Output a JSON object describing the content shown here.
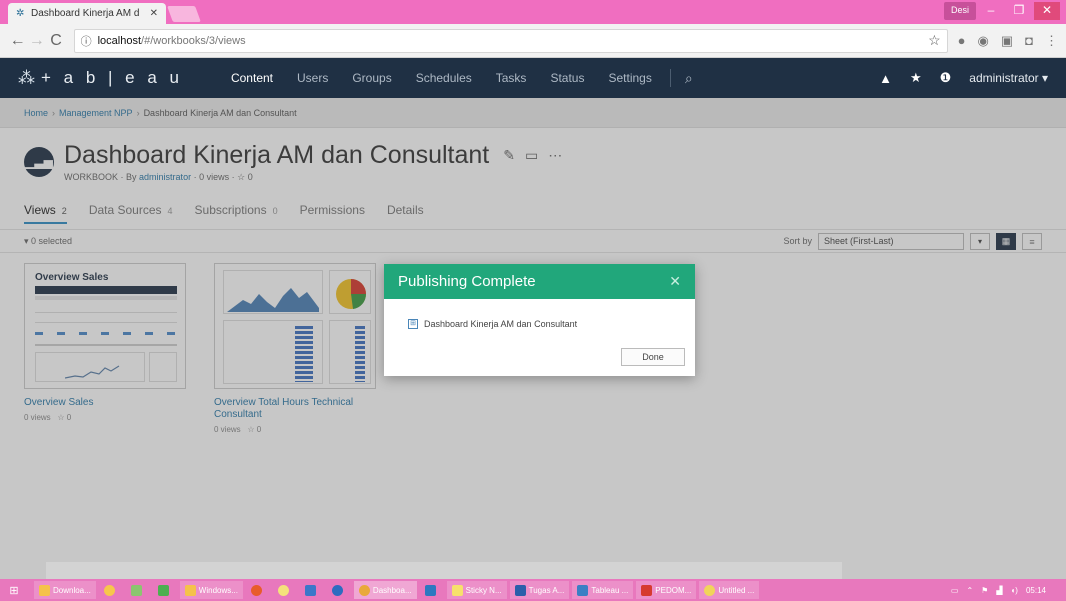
{
  "browser": {
    "tab_title": "Dashboard Kinerja AM d",
    "url_host": "localhost",
    "url_path": "/#/workbooks/3/views",
    "user_badge": "Desi"
  },
  "header": {
    "logo_text": "+ a b | e a u",
    "nav": [
      "Content",
      "Users",
      "Groups",
      "Schedules",
      "Tasks",
      "Status",
      "Settings"
    ],
    "active": "Content",
    "username": "administrator ▾"
  },
  "breadcrumb": {
    "items": [
      "Home",
      "Management NPP"
    ],
    "current": "Dashboard Kinerja AM dan Consultant"
  },
  "workbook": {
    "title": "Dashboard Kinerja AM dan Consultant",
    "type": "WORKBOOK",
    "by_label": "By",
    "by_user": "administrator",
    "views_count": "0 views",
    "favorites": "0"
  },
  "tabs": [
    {
      "label": "Views",
      "count": "2"
    },
    {
      "label": "Data Sources",
      "count": "4"
    },
    {
      "label": "Subscriptions",
      "count": "0"
    },
    {
      "label": "Permissions",
      "count": ""
    },
    {
      "label": "Details",
      "count": ""
    }
  ],
  "toolbar": {
    "selected": "▾ 0 selected",
    "sort_label": "Sort by",
    "sort_value": "Sheet (First-Last)"
  },
  "cards": [
    {
      "name": "Overview Sales",
      "views": "0 views",
      "fav": "0",
      "thumb_title": "Overview Sales"
    },
    {
      "name": "Overview Total Hours Technical Consultant",
      "views": "0 views",
      "fav": "0"
    }
  ],
  "modal": {
    "title": "Publishing Complete",
    "item": "Dashboard Kinerja AM dan Consultant",
    "done": "Done"
  },
  "taskbar": {
    "items": [
      "Downloa...",
      "Windows...",
      "Dashboa...",
      "Sticky N...",
      "Tugas A...",
      "Tableau ...",
      "PEDOM...",
      "Untitled ..."
    ],
    "clock": "05:14"
  }
}
